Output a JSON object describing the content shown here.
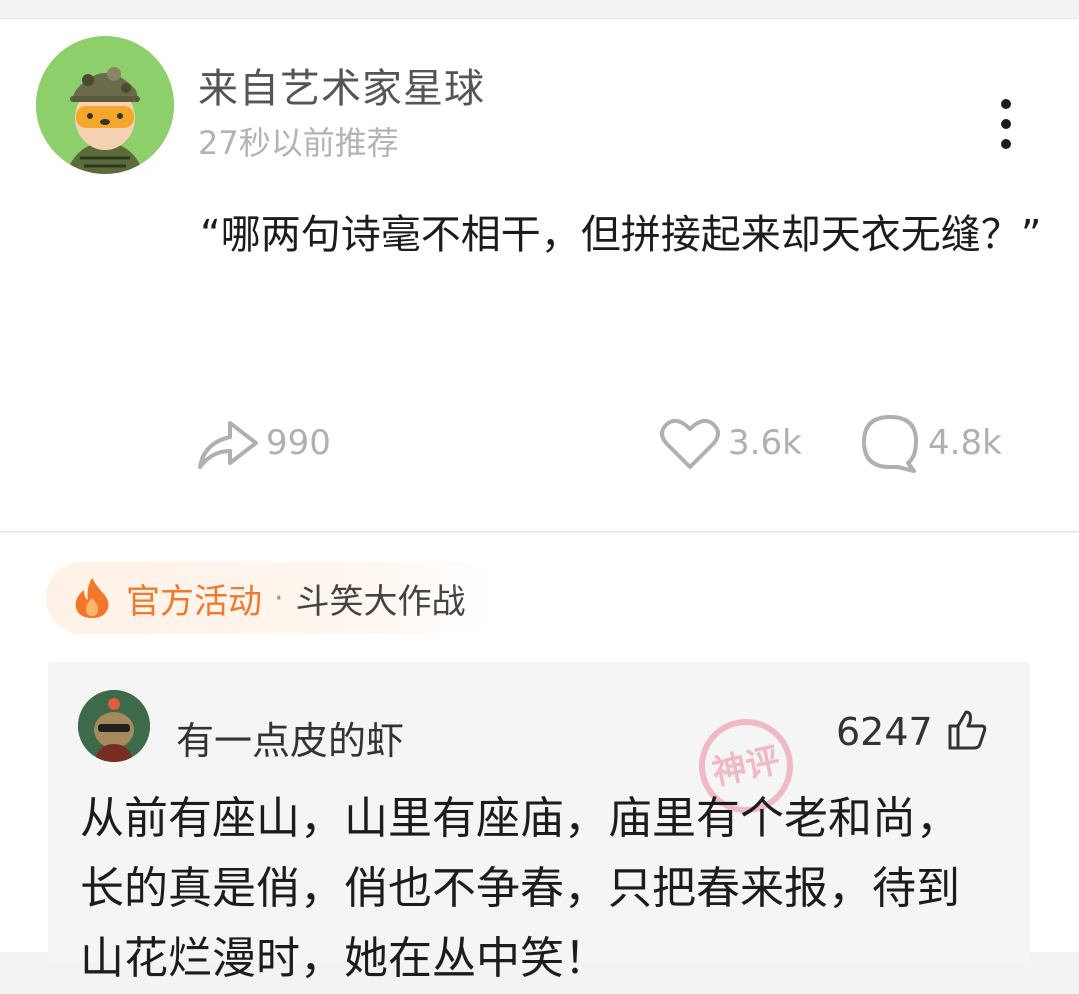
{
  "post": {
    "author": "来自艺术家星球",
    "time": "27秒以前推荐",
    "text": "“哪两句诗毫不相干，但拼接起来却天衣无缝？”",
    "actions": {
      "share_count": "990",
      "like_count": "3.6k",
      "comment_count": "4.8k"
    }
  },
  "activity": {
    "label": "官方活动",
    "separator": "·",
    "name": "斗笑大作战"
  },
  "comment": {
    "author": "有一点皮的虾",
    "likes": "6247",
    "stamp_text": "神评",
    "text": "从前有座山，山里有座庙，庙里有个老和尚，长的真是俏，俏也不争春，只把春来报，待到山花烂漫时，她在丛中笑！"
  },
  "icons": {
    "more": "more-vertical-icon",
    "share": "share-arrow-icon",
    "like": "heart-icon",
    "comment": "comment-bubble-icon",
    "fire": "fire-icon",
    "thumb": "thumbs-up-icon"
  },
  "colors": {
    "accent": "#f07a2c",
    "muted": "#b0b0b0",
    "stamp": "#e8506a"
  }
}
